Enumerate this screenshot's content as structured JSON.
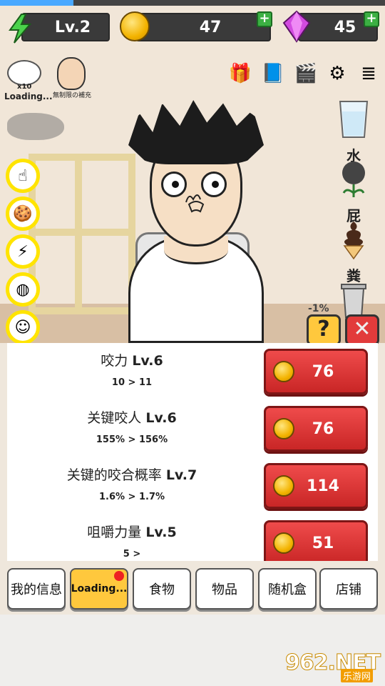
{
  "top_progress_fraction": 0.19,
  "stats": {
    "level": "Lv.2",
    "coins": "47",
    "gems": "45"
  },
  "left": {
    "egg_count": "x10",
    "egg_label": "Loading...",
    "npc_label": "無制限の補充"
  },
  "items": [
    {
      "label": "水",
      "icon": "water-glass-icon"
    },
    {
      "label": "屁",
      "icon": "gas-cloud-icon"
    },
    {
      "label": "粪",
      "icon": "ice-cream-poop-icon"
    },
    {
      "label": "",
      "icon": "trash-can-icon"
    }
  ],
  "percent_tag": "-1%",
  "upgrades": [
    {
      "name": "咬力",
      "level": "Lv.6",
      "delta": "10 > 11",
      "price": "76"
    },
    {
      "name": "关键咬人",
      "level": "Lv.6",
      "delta": "155% > 156%",
      "price": "76"
    },
    {
      "name": "关键的咬合概率",
      "level": "Lv.7",
      "delta": "1.6% > 1.7%",
      "price": "114"
    },
    {
      "name": "咀嚼力量",
      "level": "Lv.5",
      "delta": "5 >",
      "price": "51"
    }
  ],
  "tabs": [
    {
      "label": "我的信息"
    },
    {
      "label": "Loading..."
    },
    {
      "label": "食物"
    },
    {
      "label": "物品"
    },
    {
      "label": "随机盒"
    },
    {
      "label": "店铺"
    }
  ],
  "watermark": {
    "big": "962.NET",
    "small": "乐游网"
  }
}
